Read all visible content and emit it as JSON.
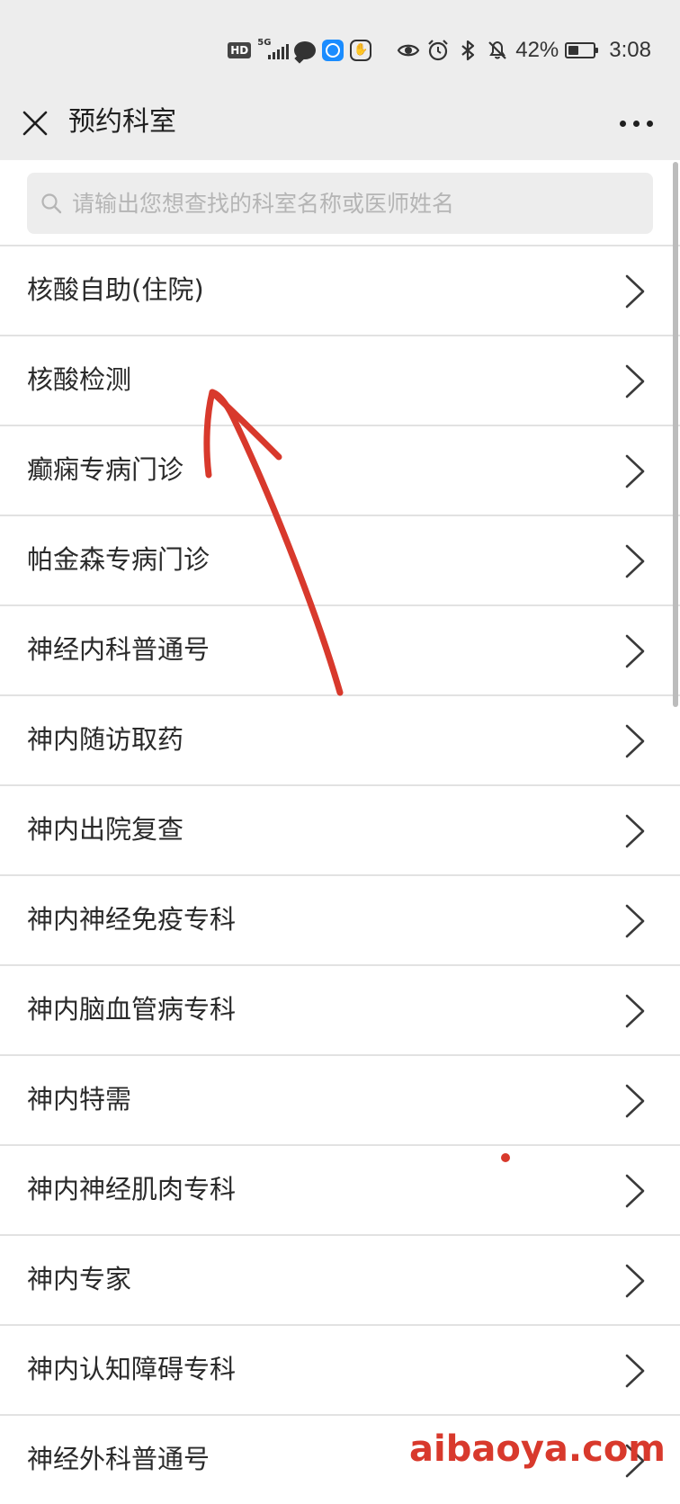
{
  "status_bar": {
    "hd": "HD",
    "net": "5G",
    "battery_percent": "42%",
    "battery_level": 0.42,
    "time": "3:08"
  },
  "nav": {
    "title": "预约科室"
  },
  "search": {
    "placeholder": "请输出您想查找的科室名称或医师姓名"
  },
  "departments": [
    {
      "label": "核酸自助(住院)"
    },
    {
      "label": "核酸检测"
    },
    {
      "label": "癫痫专病门诊"
    },
    {
      "label": "帕金森专病门诊"
    },
    {
      "label": "神经内科普通号"
    },
    {
      "label": "神内随访取药"
    },
    {
      "label": "神内出院复查"
    },
    {
      "label": "神内神经免疫专科"
    },
    {
      "label": "神内脑血管病专科"
    },
    {
      "label": "神内特需"
    },
    {
      "label": "神内神经肌肉专科"
    },
    {
      "label": "神内专家"
    },
    {
      "label": "神内认知障碍专科"
    },
    {
      "label": "神经外科普通号"
    }
  ],
  "watermark": "aibaoya.com",
  "colors": {
    "header_bg": "#ededed",
    "annotation": "#d8392c",
    "divider": "#e2e2e2"
  }
}
